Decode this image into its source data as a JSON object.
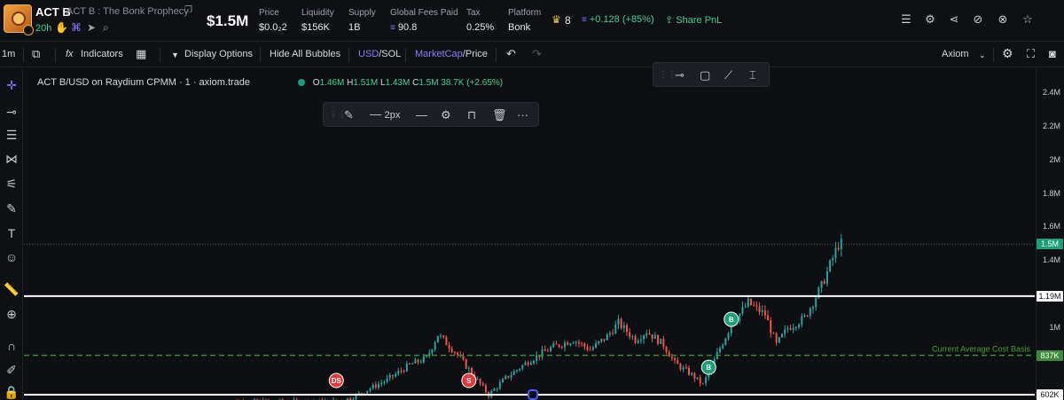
{
  "header": {
    "ticker": "ACT B",
    "full_name": "ACT B : The Bonk Prophecy",
    "age": "20h",
    "market_cap": "$1.5M",
    "stats": [
      {
        "label": "Price",
        "value": "$0.0₂2"
      },
      {
        "label": "Liquidity",
        "value": "$156K"
      },
      {
        "label": "Supply",
        "value": "1B"
      },
      {
        "label": "Global Fees Paid",
        "value": "90.8"
      },
      {
        "label": "Tax",
        "value": "0.25%"
      },
      {
        "label": "Platform",
        "value": "Bonk"
      }
    ],
    "holders_count": "8",
    "pnl": "+0.128 (+85%)",
    "share_label": "Share PnL",
    "icons": [
      "list-icon",
      "gear-icon",
      "share-icon",
      "eye-off-icon",
      "hide-icon",
      "star-icon"
    ]
  },
  "toolbar": {
    "interval": "1m",
    "indicators_label": "Indicators",
    "display_options_label": "Display Options",
    "hide_bubbles_label": "Hide All Bubbles",
    "currency_active": "USD",
    "currency_other": "/SOL",
    "mode_active": "MarketCap",
    "mode_other": "/Price",
    "provider": "Axiom"
  },
  "legend": {
    "title": "ACT B/USD on Raydium CPMM · 1 · axiom.trade",
    "o_label": "O",
    "o": "1.46M",
    "h_label": "H",
    "h": "1.51M",
    "l_label": "L",
    "l": "1.43M",
    "c_label": "C",
    "c": "1.5M",
    "change": "38.7K (+2.65%)"
  },
  "draw_toolbar": {
    "width_label": "2px"
  },
  "colors": {
    "up": "#26a69a",
    "down": "#ef5350",
    "accent": "#8a7dff",
    "green": "#3fcf8e",
    "avg_line": "#3c8a3a"
  },
  "chart_data": {
    "type": "candlestick",
    "y_ticks": [
      "2.4M",
      "2.2M",
      "2M",
      "1.8M",
      "1.6M",
      "1.4M",
      "1M"
    ],
    "ylim": [
      570000,
      2550000
    ],
    "current_price_label": "1.5M",
    "current_price": 1500000,
    "levels": [
      {
        "label": "1.19M",
        "value": 1190000
      },
      {
        "label": "602K",
        "value": 602000
      }
    ],
    "avg_cost": {
      "label": "837K",
      "value": 837000,
      "text": "Current Average Cost Basis"
    },
    "markers": [
      {
        "text": "DS",
        "type": "sell",
        "idx": 40
      },
      {
        "text": "S",
        "type": "sell",
        "idx": 87
      },
      {
        "text": "B",
        "type": "buy",
        "idx": 172
      },
      {
        "text": "B",
        "type": "buy",
        "idx": 180
      }
    ],
    "close_path": [
      [
        0,
        560000
      ],
      [
        38,
        560000
      ],
      [
        45,
        580000
      ],
      [
        52,
        640000
      ],
      [
        58,
        690000
      ],
      [
        66,
        780000
      ],
      [
        72,
        820000
      ],
      [
        76,
        960000
      ],
      [
        82,
        860000
      ],
      [
        88,
        730000
      ],
      [
        94,
        600000
      ],
      [
        100,
        700000
      ],
      [
        108,
        800000
      ],
      [
        116,
        880000
      ],
      [
        124,
        930000
      ],
      [
        130,
        870000
      ],
      [
        136,
        950000
      ],
      [
        140,
        1030000
      ],
      [
        146,
        930000
      ],
      [
        150,
        980000
      ],
      [
        156,
        900000
      ],
      [
        160,
        790000
      ],
      [
        166,
        720000
      ],
      [
        170,
        660000
      ],
      [
        176,
        880000
      ],
      [
        180,
        1020000
      ],
      [
        186,
        1150000
      ],
      [
        192,
        1080000
      ],
      [
        196,
        900000
      ],
      [
        200,
        1000000
      ],
      [
        206,
        1060000
      ],
      [
        212,
        1250000
      ],
      [
        218,
        1500000
      ]
    ]
  }
}
